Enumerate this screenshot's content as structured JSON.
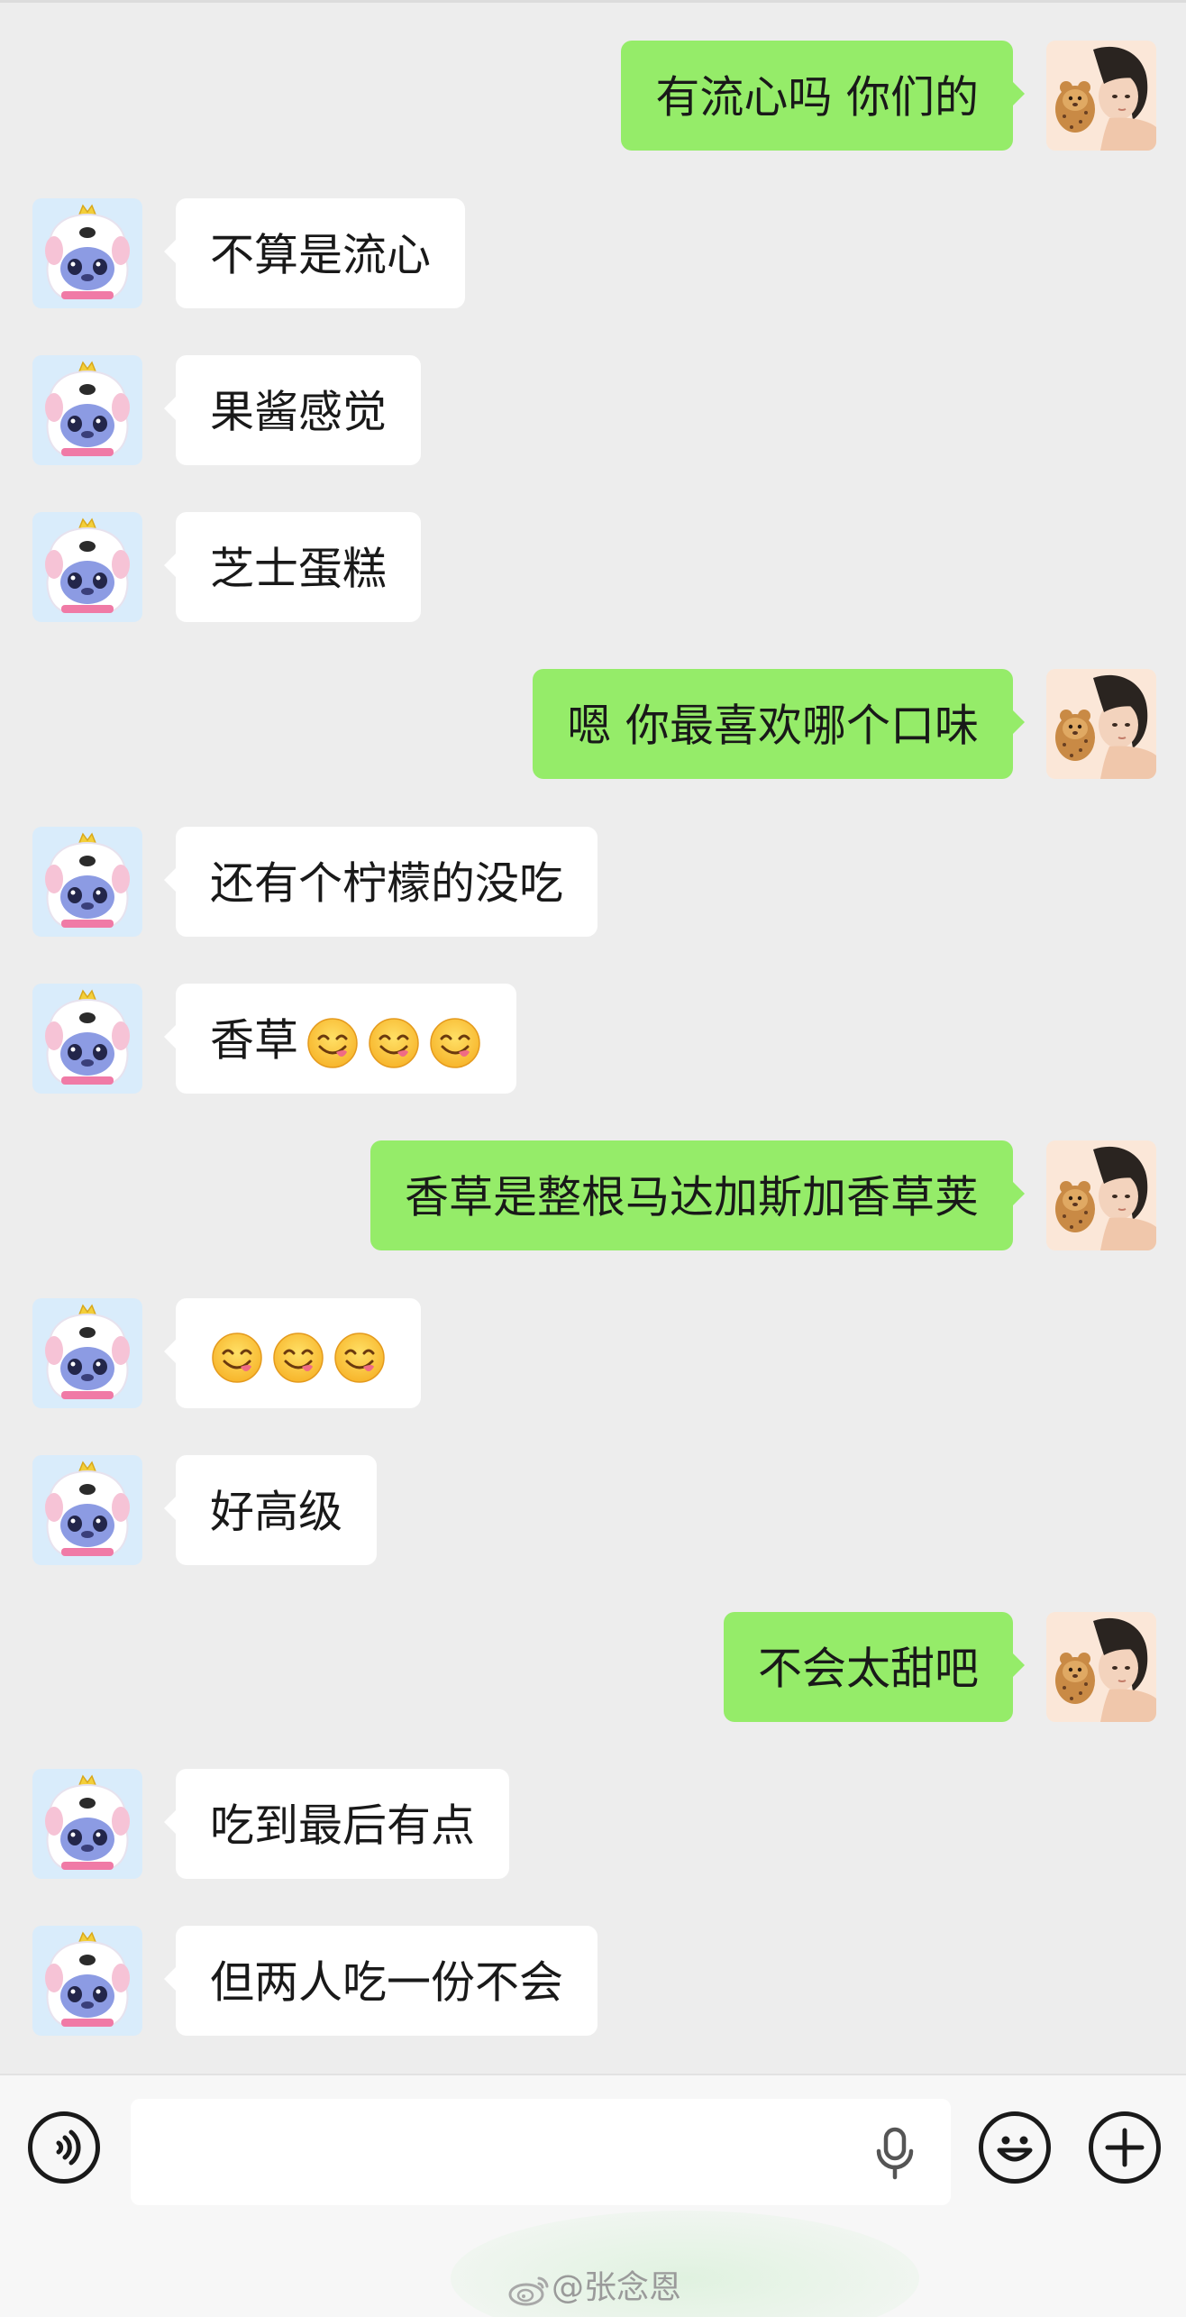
{
  "chat": {
    "messages": [
      {
        "side": "out",
        "text": "有流心吗 你们的",
        "emoji_count": 0
      },
      {
        "side": "in",
        "text": "不算是流心",
        "emoji_count": 0
      },
      {
        "side": "in",
        "text": "果酱感觉",
        "emoji_count": 0
      },
      {
        "side": "in",
        "text": "芝士蛋糕",
        "emoji_count": 0
      },
      {
        "side": "out",
        "text": "嗯 你最喜欢哪个口味",
        "emoji_count": 0
      },
      {
        "side": "in",
        "text": "还有个柠檬的没吃",
        "emoji_count": 0
      },
      {
        "side": "in",
        "text": "香草",
        "emoji_count": 3
      },
      {
        "side": "out",
        "text": "香草是整根马达加斯加香草荚",
        "emoji_count": 0
      },
      {
        "side": "in",
        "text": "",
        "emoji_count": 3
      },
      {
        "side": "in",
        "text": "好高级",
        "emoji_count": 0
      },
      {
        "side": "out",
        "text": "不会太甜吧",
        "emoji_count": 0
      },
      {
        "side": "in",
        "text": "吃到最后有点",
        "emoji_count": 0
      },
      {
        "side": "in",
        "text": "但两人吃一份不会",
        "emoji_count": 0
      }
    ],
    "emoji_name": "yum-face-emoji"
  },
  "input_bar": {
    "voice_icon": "voice-input-icon",
    "mic_icon": "microphone-icon",
    "emoji_icon": "smiley-icon",
    "plus_icon": "plus-icon"
  },
  "watermark": {
    "text": "@张念恩",
    "logo_icon": "weibo-icon"
  },
  "colors": {
    "background": "#ededed",
    "outgoing_bubble": "#95ec69",
    "incoming_bubble": "#ffffff",
    "text": "#191919"
  }
}
